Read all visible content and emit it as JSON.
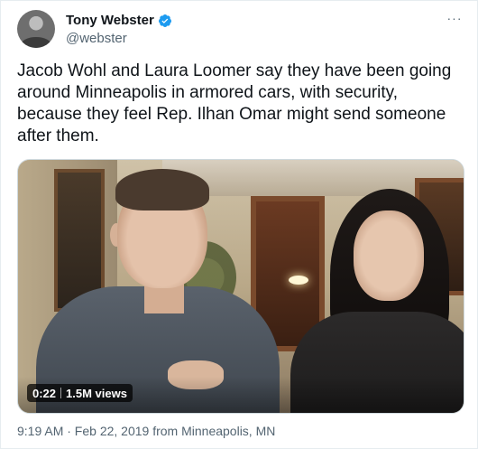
{
  "author": {
    "display_name": "Tony Webster",
    "handle": "@webster",
    "verified": true,
    "verified_color": "#1d9bf0"
  },
  "more_menu": {
    "icon": "more-horizontal-icon",
    "glyph": "···"
  },
  "tweet": {
    "text": "Jacob Wohl and Laura Loomer say they have been going around Minneapolis in armored cars, with security, because they feel Rep. Ilhan Omar might send someone after them."
  },
  "media": {
    "type": "video",
    "duration": "0:22",
    "views": "1.5M views"
  },
  "footer": {
    "timestamp": "9:19 AM · Feb 22, 2019 from Minneapolis, MN"
  },
  "colors": {
    "text_primary": "#0f1419",
    "text_secondary": "#536471",
    "border": "#cfd9de"
  }
}
